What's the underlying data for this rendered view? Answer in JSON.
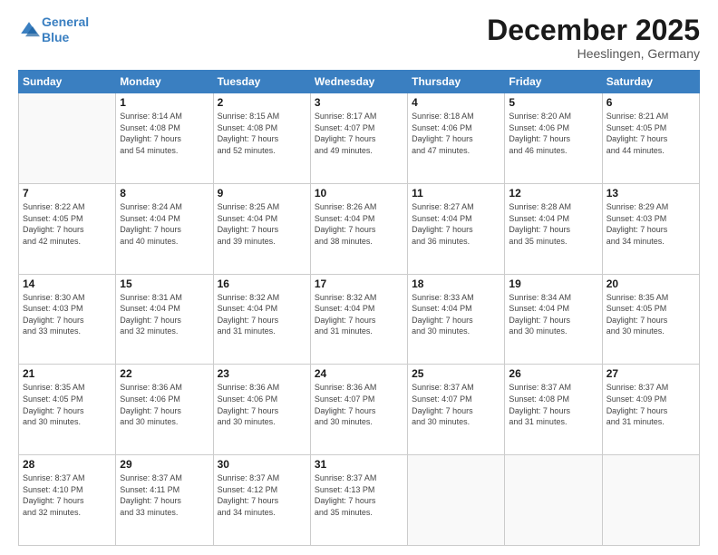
{
  "header": {
    "logo_line1": "General",
    "logo_line2": "Blue",
    "month_title": "December 2025",
    "location": "Heeslingen, Germany"
  },
  "weekdays": [
    "Sunday",
    "Monday",
    "Tuesday",
    "Wednesday",
    "Thursday",
    "Friday",
    "Saturday"
  ],
  "weeks": [
    [
      {
        "day": "",
        "detail": ""
      },
      {
        "day": "1",
        "detail": "Sunrise: 8:14 AM\nSunset: 4:08 PM\nDaylight: 7 hours\nand 54 minutes."
      },
      {
        "day": "2",
        "detail": "Sunrise: 8:15 AM\nSunset: 4:08 PM\nDaylight: 7 hours\nand 52 minutes."
      },
      {
        "day": "3",
        "detail": "Sunrise: 8:17 AM\nSunset: 4:07 PM\nDaylight: 7 hours\nand 49 minutes."
      },
      {
        "day": "4",
        "detail": "Sunrise: 8:18 AM\nSunset: 4:06 PM\nDaylight: 7 hours\nand 47 minutes."
      },
      {
        "day": "5",
        "detail": "Sunrise: 8:20 AM\nSunset: 4:06 PM\nDaylight: 7 hours\nand 46 minutes."
      },
      {
        "day": "6",
        "detail": "Sunrise: 8:21 AM\nSunset: 4:05 PM\nDaylight: 7 hours\nand 44 minutes."
      }
    ],
    [
      {
        "day": "7",
        "detail": "Sunrise: 8:22 AM\nSunset: 4:05 PM\nDaylight: 7 hours\nand 42 minutes."
      },
      {
        "day": "8",
        "detail": "Sunrise: 8:24 AM\nSunset: 4:04 PM\nDaylight: 7 hours\nand 40 minutes."
      },
      {
        "day": "9",
        "detail": "Sunrise: 8:25 AM\nSunset: 4:04 PM\nDaylight: 7 hours\nand 39 minutes."
      },
      {
        "day": "10",
        "detail": "Sunrise: 8:26 AM\nSunset: 4:04 PM\nDaylight: 7 hours\nand 38 minutes."
      },
      {
        "day": "11",
        "detail": "Sunrise: 8:27 AM\nSunset: 4:04 PM\nDaylight: 7 hours\nand 36 minutes."
      },
      {
        "day": "12",
        "detail": "Sunrise: 8:28 AM\nSunset: 4:04 PM\nDaylight: 7 hours\nand 35 minutes."
      },
      {
        "day": "13",
        "detail": "Sunrise: 8:29 AM\nSunset: 4:03 PM\nDaylight: 7 hours\nand 34 minutes."
      }
    ],
    [
      {
        "day": "14",
        "detail": "Sunrise: 8:30 AM\nSunset: 4:03 PM\nDaylight: 7 hours\nand 33 minutes."
      },
      {
        "day": "15",
        "detail": "Sunrise: 8:31 AM\nSunset: 4:04 PM\nDaylight: 7 hours\nand 32 minutes."
      },
      {
        "day": "16",
        "detail": "Sunrise: 8:32 AM\nSunset: 4:04 PM\nDaylight: 7 hours\nand 31 minutes."
      },
      {
        "day": "17",
        "detail": "Sunrise: 8:32 AM\nSunset: 4:04 PM\nDaylight: 7 hours\nand 31 minutes."
      },
      {
        "day": "18",
        "detail": "Sunrise: 8:33 AM\nSunset: 4:04 PM\nDaylight: 7 hours\nand 30 minutes."
      },
      {
        "day": "19",
        "detail": "Sunrise: 8:34 AM\nSunset: 4:04 PM\nDaylight: 7 hours\nand 30 minutes."
      },
      {
        "day": "20",
        "detail": "Sunrise: 8:35 AM\nSunset: 4:05 PM\nDaylight: 7 hours\nand 30 minutes."
      }
    ],
    [
      {
        "day": "21",
        "detail": "Sunrise: 8:35 AM\nSunset: 4:05 PM\nDaylight: 7 hours\nand 30 minutes."
      },
      {
        "day": "22",
        "detail": "Sunrise: 8:36 AM\nSunset: 4:06 PM\nDaylight: 7 hours\nand 30 minutes."
      },
      {
        "day": "23",
        "detail": "Sunrise: 8:36 AM\nSunset: 4:06 PM\nDaylight: 7 hours\nand 30 minutes."
      },
      {
        "day": "24",
        "detail": "Sunrise: 8:36 AM\nSunset: 4:07 PM\nDaylight: 7 hours\nand 30 minutes."
      },
      {
        "day": "25",
        "detail": "Sunrise: 8:37 AM\nSunset: 4:07 PM\nDaylight: 7 hours\nand 30 minutes."
      },
      {
        "day": "26",
        "detail": "Sunrise: 8:37 AM\nSunset: 4:08 PM\nDaylight: 7 hours\nand 31 minutes."
      },
      {
        "day": "27",
        "detail": "Sunrise: 8:37 AM\nSunset: 4:09 PM\nDaylight: 7 hours\nand 31 minutes."
      }
    ],
    [
      {
        "day": "28",
        "detail": "Sunrise: 8:37 AM\nSunset: 4:10 PM\nDaylight: 7 hours\nand 32 minutes."
      },
      {
        "day": "29",
        "detail": "Sunrise: 8:37 AM\nSunset: 4:11 PM\nDaylight: 7 hours\nand 33 minutes."
      },
      {
        "day": "30",
        "detail": "Sunrise: 8:37 AM\nSunset: 4:12 PM\nDaylight: 7 hours\nand 34 minutes."
      },
      {
        "day": "31",
        "detail": "Sunrise: 8:37 AM\nSunset: 4:13 PM\nDaylight: 7 hours\nand 35 minutes."
      },
      {
        "day": "",
        "detail": ""
      },
      {
        "day": "",
        "detail": ""
      },
      {
        "day": "",
        "detail": ""
      }
    ]
  ]
}
